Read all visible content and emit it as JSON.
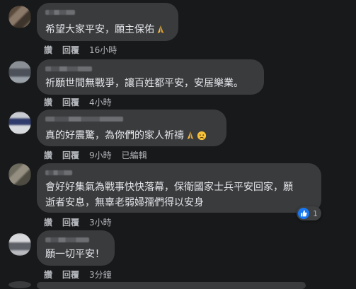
{
  "comments": [
    {
      "text": "希望大家平安，願主保佑",
      "emoji": "folded-hands",
      "actions": {
        "like": "讚",
        "reply": "回覆",
        "time": "16小時"
      }
    },
    {
      "text": "祈願世間無戰爭，讓百姓都平安，安居樂業。",
      "actions": {
        "like": "讚",
        "reply": "回覆",
        "time": "4小時"
      }
    },
    {
      "text": "真的好震驚，為你們的家人祈禱",
      "emoji": "folded-hands-sad-face",
      "actions": {
        "like": "讚",
        "reply": "回覆",
        "time": "9小時",
        "edited": "已編輯"
      }
    },
    {
      "lines": [
        "會好好集氣為戰事快快落幕，保衛國家士兵平安回家，願",
        "逝者安息，無辜老弱婦孺們得以安身"
      ],
      "actions": {
        "like": "讚",
        "reply": "回覆",
        "time": "3小時"
      },
      "reactions": {
        "icon": "like-icon",
        "count": "1"
      }
    },
    {
      "text": "願一切平安！",
      "actions": {
        "like": "讚",
        "reply": "回覆",
        "time": "3分鐘"
      }
    }
  ],
  "colors": {
    "background": "#18191a",
    "bubble": "#3a3b3c",
    "like_blue": "#1877f2",
    "meta_text": "#b0b3b8"
  }
}
